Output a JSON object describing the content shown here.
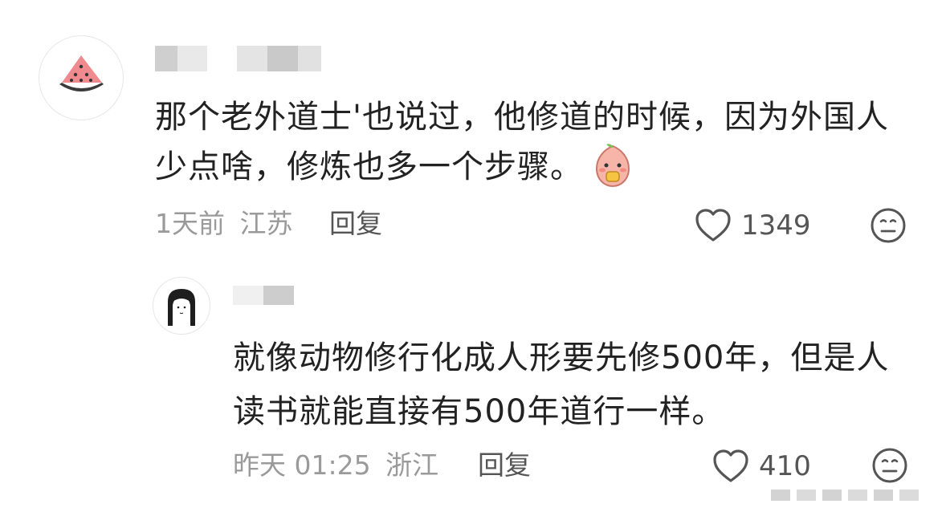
{
  "comment": {
    "avatar_icon": "watermelon-icon",
    "text_line1": "那个老外道士'也说过，他修道的时候，因为外国人",
    "text_line2": "少点啥，修炼也多一个步骤。",
    "emoji_icon": "peach-mascot-sticker-icon",
    "time": "1天前",
    "location": "江苏",
    "reply_label": "回复",
    "like_count": "1349",
    "like_icon": "heart-outline-icon",
    "dislike_icon": "neutral-face-icon"
  },
  "reply": {
    "avatar_icon": "girl-portrait-icon",
    "text_line1": "就像动物修行化成人形要先修500年，但是人",
    "text_line2": "读书就能直接有500年道行一样。",
    "time": "昨天 01:25",
    "location": "浙江",
    "reply_label": "回复",
    "like_count": "410",
    "like_icon": "heart-outline-icon",
    "dislike_icon": "neutral-face-icon"
  },
  "colors": {
    "text": "#222222",
    "meta": "#9a9a9a",
    "icon": "#555555",
    "blurred_name": "#d6d6d6"
  }
}
